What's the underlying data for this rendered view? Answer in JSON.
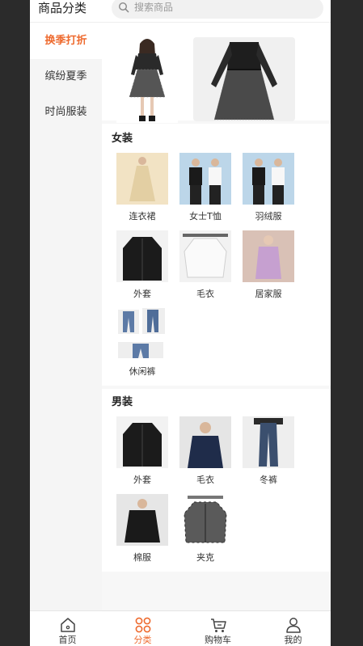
{
  "header": {
    "title": "商品分类",
    "search_placeholder": "搜索商品"
  },
  "sidebar": {
    "items": [
      {
        "label": "换季打折",
        "active": true
      },
      {
        "label": "缤纷夏季",
        "active": false
      },
      {
        "label": "时尚服装",
        "active": false
      }
    ]
  },
  "sections": [
    {
      "title": "女装",
      "items": [
        "连衣裙",
        "女士T恤",
        "羽绒服",
        "外套",
        "毛衣",
        "居家服",
        "休闲裤"
      ]
    },
    {
      "title": "男装",
      "items": [
        "外套",
        "毛衣",
        "冬裤",
        "棉服",
        "夹克"
      ]
    }
  ],
  "tabbar": {
    "items": [
      {
        "label": "首页",
        "icon": "home-icon"
      },
      {
        "label": "分类",
        "icon": "category-icon",
        "active": true
      },
      {
        "label": "购物车",
        "icon": "cart-icon"
      },
      {
        "label": "我的",
        "icon": "user-icon"
      }
    ]
  },
  "colors": {
    "accent": "#ee6a2e",
    "sidebar_bg": "#f5f5f5",
    "content_bg": "#f7f7f7"
  }
}
